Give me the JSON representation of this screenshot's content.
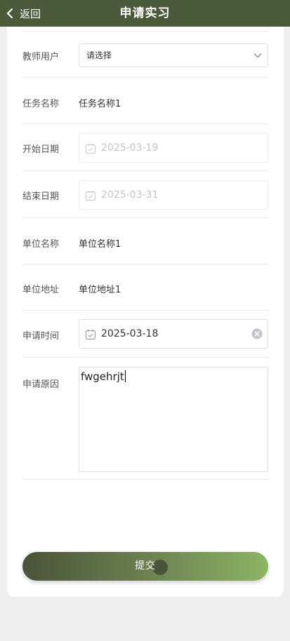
{
  "header": {
    "back_label": "返回",
    "title": "申请实习"
  },
  "form": {
    "teacher": {
      "label": "教师用户",
      "placeholder": "请选择"
    },
    "task_name": {
      "label": "任务名称",
      "value": "任务名称1"
    },
    "start_date": {
      "label": "开始日期",
      "value": "2025-03-19"
    },
    "end_date": {
      "label": "结束日期",
      "value": "2025-03-31"
    },
    "company_name": {
      "label": "单位名称",
      "value": "单位名称1"
    },
    "company_address": {
      "label": "单位地址",
      "value": "单位地址1"
    },
    "apply_time": {
      "label": "申请时间",
      "value": "2025-03-18"
    },
    "reason": {
      "label": "申请原因",
      "value": "fwgehrjt"
    }
  },
  "submit_label": "提交",
  "colors": {
    "header_bg": "#4c5a3c",
    "button_gradient_start": "#4a5439",
    "button_gradient_end": "#8db466"
  },
  "icons": [
    "chevron-left-icon",
    "chevron-down-icon",
    "calendar-icon",
    "clear-icon"
  ]
}
